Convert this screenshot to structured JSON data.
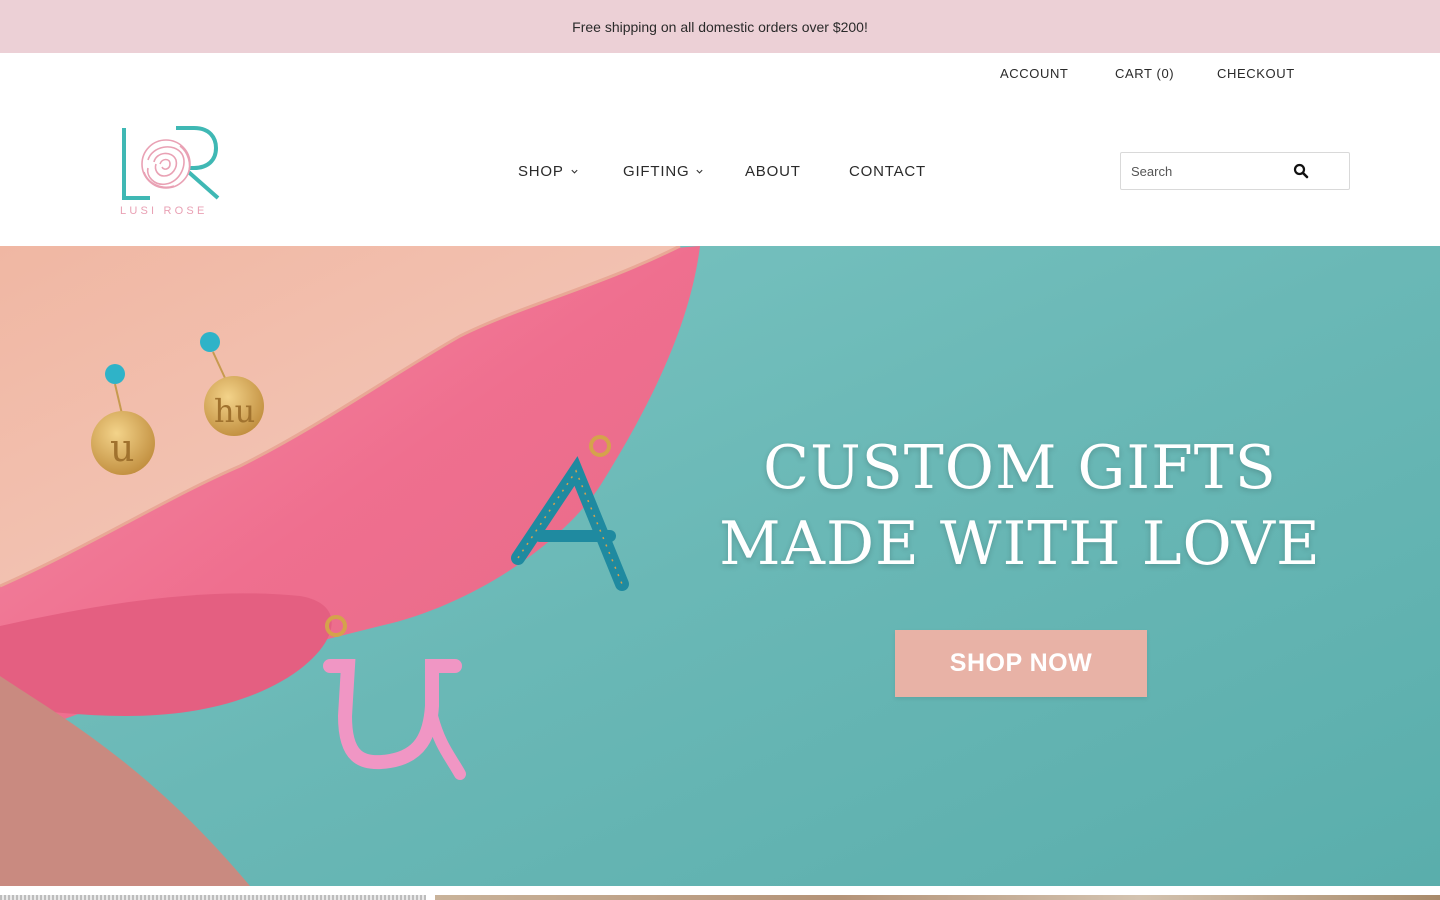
{
  "announcement": {
    "text": "Free shipping on all domestic orders over $200!"
  },
  "utility_nav": {
    "account": "ACCOUNT",
    "cart": "CART (0)",
    "checkout": "CHECKOUT"
  },
  "brand": {
    "name": "LUSI ROSE",
    "monogram": "LR"
  },
  "main_nav": {
    "items": [
      {
        "label": "SHOP",
        "has_dropdown": true
      },
      {
        "label": "GIFTING",
        "has_dropdown": true
      },
      {
        "label": "ABOUT",
        "has_dropdown": false
      },
      {
        "label": "CONTACT",
        "has_dropdown": false
      }
    ]
  },
  "search": {
    "placeholder": "Search",
    "icon": "search-icon"
  },
  "hero": {
    "title_line1": "CUSTOM GIFTS",
    "title_line2": "MADE WITH LOVE",
    "cta_label": "SHOP NOW"
  },
  "colors": {
    "announcement_bg": "#ecd0d6",
    "brand_teal": "#3fb8b4",
    "brand_pink": "#e9a1b4",
    "hero_teal": "#6ab8b6",
    "cta_bg": "#e8b2a6"
  }
}
